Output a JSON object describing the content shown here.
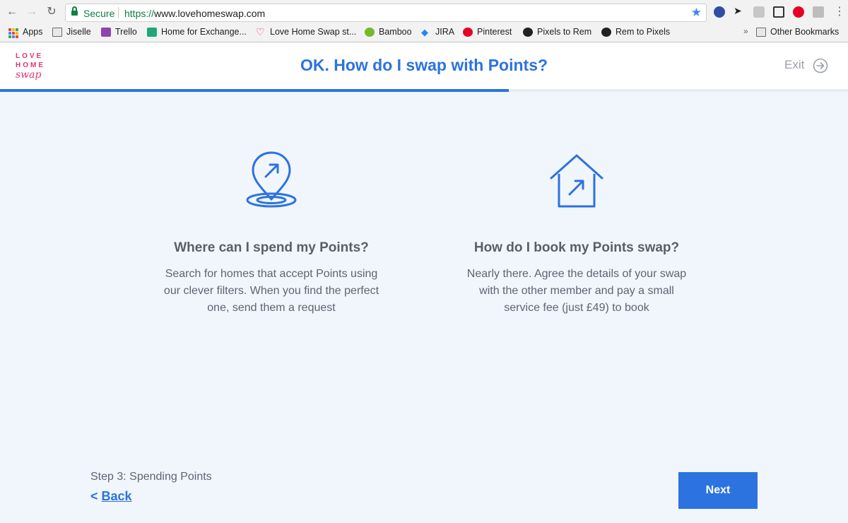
{
  "browser": {
    "security_label": "Secure",
    "url_scheme": "https://",
    "url_host": "www.lovehomeswap.com",
    "bookmarks": [
      {
        "label": "Apps",
        "icon": "apps-grid-icon"
      },
      {
        "label": "Jiselle",
        "icon": "folder-icon"
      },
      {
        "label": "Trello",
        "icon": "trello-icon"
      },
      {
        "label": "Home for Exchange...",
        "icon": "home-for-exchange-icon"
      },
      {
        "label": "Love Home Swap st...",
        "icon": "heart-icon"
      },
      {
        "label": "Bamboo",
        "icon": "bamboo-icon"
      },
      {
        "label": "JIRA",
        "icon": "jira-icon"
      },
      {
        "label": "Pinterest",
        "icon": "pinterest-icon"
      },
      {
        "label": "Pixels to Rem",
        "icon": "ninja-icon"
      },
      {
        "label": "Rem to Pixels",
        "icon": "ninja-icon"
      }
    ],
    "overflow": "»",
    "other_bookmarks": "Other Bookmarks"
  },
  "header": {
    "logo": [
      "LOVE",
      "HOME",
      "swap"
    ],
    "title": "OK. How do I swap with Points?",
    "exit_label": "Exit"
  },
  "progress": {
    "fraction": 0.6
  },
  "cards": [
    {
      "icon": "map-pin-arrow-icon",
      "title": "Where can I spend my Points?",
      "text_lines": [
        "Search for homes that accept Points using",
        "our clever filters. When you find the perfect",
        "one, send them a request"
      ]
    },
    {
      "icon": "house-arrow-icon",
      "title": "How do I book my Points swap?",
      "text_lines": [
        "Nearly there. Agree the details of your swap",
        "with the other member and pay a small",
        "service fee (just £49) to book"
      ]
    }
  ],
  "footer": {
    "step_label": "Step 3: Spending Points",
    "back_prefix": "<",
    "back_label": "Back",
    "next_label": "Next"
  },
  "colors": {
    "accent": "#2c73e0",
    "brand": "#e8336d",
    "page_bg": "#f1f5fc"
  }
}
